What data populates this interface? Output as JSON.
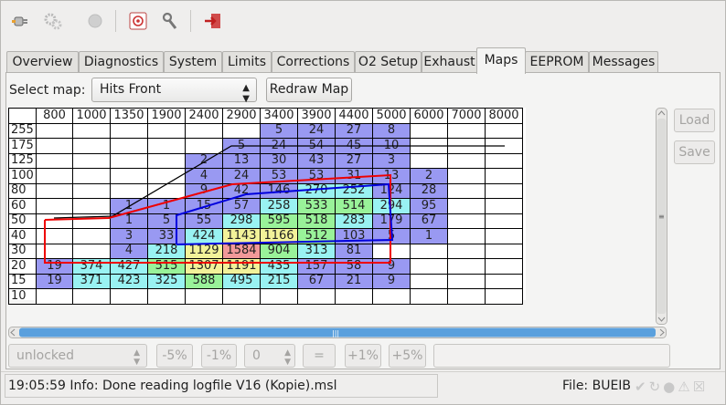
{
  "toolbar": {
    "buttons": [
      {
        "icon": "connect-plug-icon"
      },
      {
        "icon": "gear-cogs-icon"
      },
      {
        "icon": "record-dot-icon"
      },
      {
        "icon": "target-chip-icon"
      },
      {
        "icon": "tools-icon"
      },
      {
        "icon": "exit-door-icon"
      }
    ]
  },
  "tabs": [
    "Overview",
    "Diagnostics",
    "System",
    "Limits",
    "Corrections",
    "O2 Setup",
    "Exhaust",
    "Maps",
    "EEPROM",
    "Messages"
  ],
  "active_tab": "Maps",
  "maps": {
    "select_label": "Select map:",
    "selected_map": "Hits Front",
    "redraw_label": "Redraw Map",
    "load_label": "Load",
    "save_label": "Save",
    "rpm": [
      "800",
      "1000",
      "1350",
      "1900",
      "2400",
      "2900",
      "3400",
      "3900",
      "4400",
      "5000",
      "6000",
      "7000",
      "8000"
    ],
    "rows": [
      {
        "load": "255",
        "cells": [
          "",
          "",
          "",
          "",
          "",
          "",
          "5",
          "24",
          "27",
          "8",
          "",
          "",
          ""
        ]
      },
      {
        "load": "175",
        "cells": [
          "",
          "",
          "",
          "",
          "",
          "5",
          "24",
          "54",
          "45",
          "10",
          "",
          "",
          ""
        ]
      },
      {
        "load": "125",
        "cells": [
          "",
          "",
          "",
          "",
          "2",
          "13",
          "30",
          "43",
          "27",
          "3",
          "",
          "",
          ""
        ]
      },
      {
        "load": "100",
        "cells": [
          "",
          "",
          "",
          "",
          "4",
          "24",
          "53",
          "53",
          "31",
          "13",
          "2",
          "",
          ""
        ]
      },
      {
        "load": "80",
        "cells": [
          "",
          "",
          "",
          "",
          "9",
          "42",
          "146",
          "270",
          "252",
          "124",
          "28",
          "",
          ""
        ]
      },
      {
        "load": "60",
        "cells": [
          "",
          "",
          "1",
          "1",
          "15",
          "57",
          "258",
          "533",
          "514",
          "294",
          "95",
          "",
          ""
        ]
      },
      {
        "load": "50",
        "cells": [
          "",
          "",
          "1",
          "5",
          "55",
          "298",
          "595",
          "518",
          "283",
          "179",
          "67",
          "",
          ""
        ]
      },
      {
        "load": "40",
        "cells": [
          "",
          "",
          "3",
          "33",
          "424",
          "1143",
          "1166",
          "512",
          "103",
          "5",
          "1",
          "",
          ""
        ]
      },
      {
        "load": "30",
        "cells": [
          "",
          "",
          "4",
          "218",
          "1129",
          "1584",
          "904",
          "313",
          "81",
          "",
          "",
          "",
          ""
        ]
      },
      {
        "load": "20",
        "cells": [
          "19",
          "374",
          "427",
          "515",
          "1307",
          "1191",
          "435",
          "157",
          "58",
          "9",
          "",
          "",
          ""
        ]
      },
      {
        "load": "15",
        "cells": [
          "19",
          "371",
          "423",
          "325",
          "588",
          "495",
          "215",
          "67",
          "21",
          "9",
          "",
          "",
          ""
        ]
      },
      {
        "load": "10",
        "cells": [
          "",
          "",
          "",
          "",
          "",
          "",
          "",
          "",
          "",
          "",
          "",
          "",
          ""
        ]
      }
    ],
    "colors": {
      "low": "#9999f2",
      "mid": "#99f2f2",
      "midhigh": "#99f299",
      "high": "#f2f299",
      "max": "#f29999"
    }
  },
  "edit_bar": {
    "lock_state": "unlocked",
    "minus5": "-5%",
    "minus1": "-1%",
    "value": "0",
    "equals": "=",
    "plus1": "+1%",
    "plus5": "+5%"
  },
  "status": {
    "message": "19:05:59 Info: Done reading logfile V16 (Kopie).msl",
    "file_label": "File: BUEIB"
  }
}
